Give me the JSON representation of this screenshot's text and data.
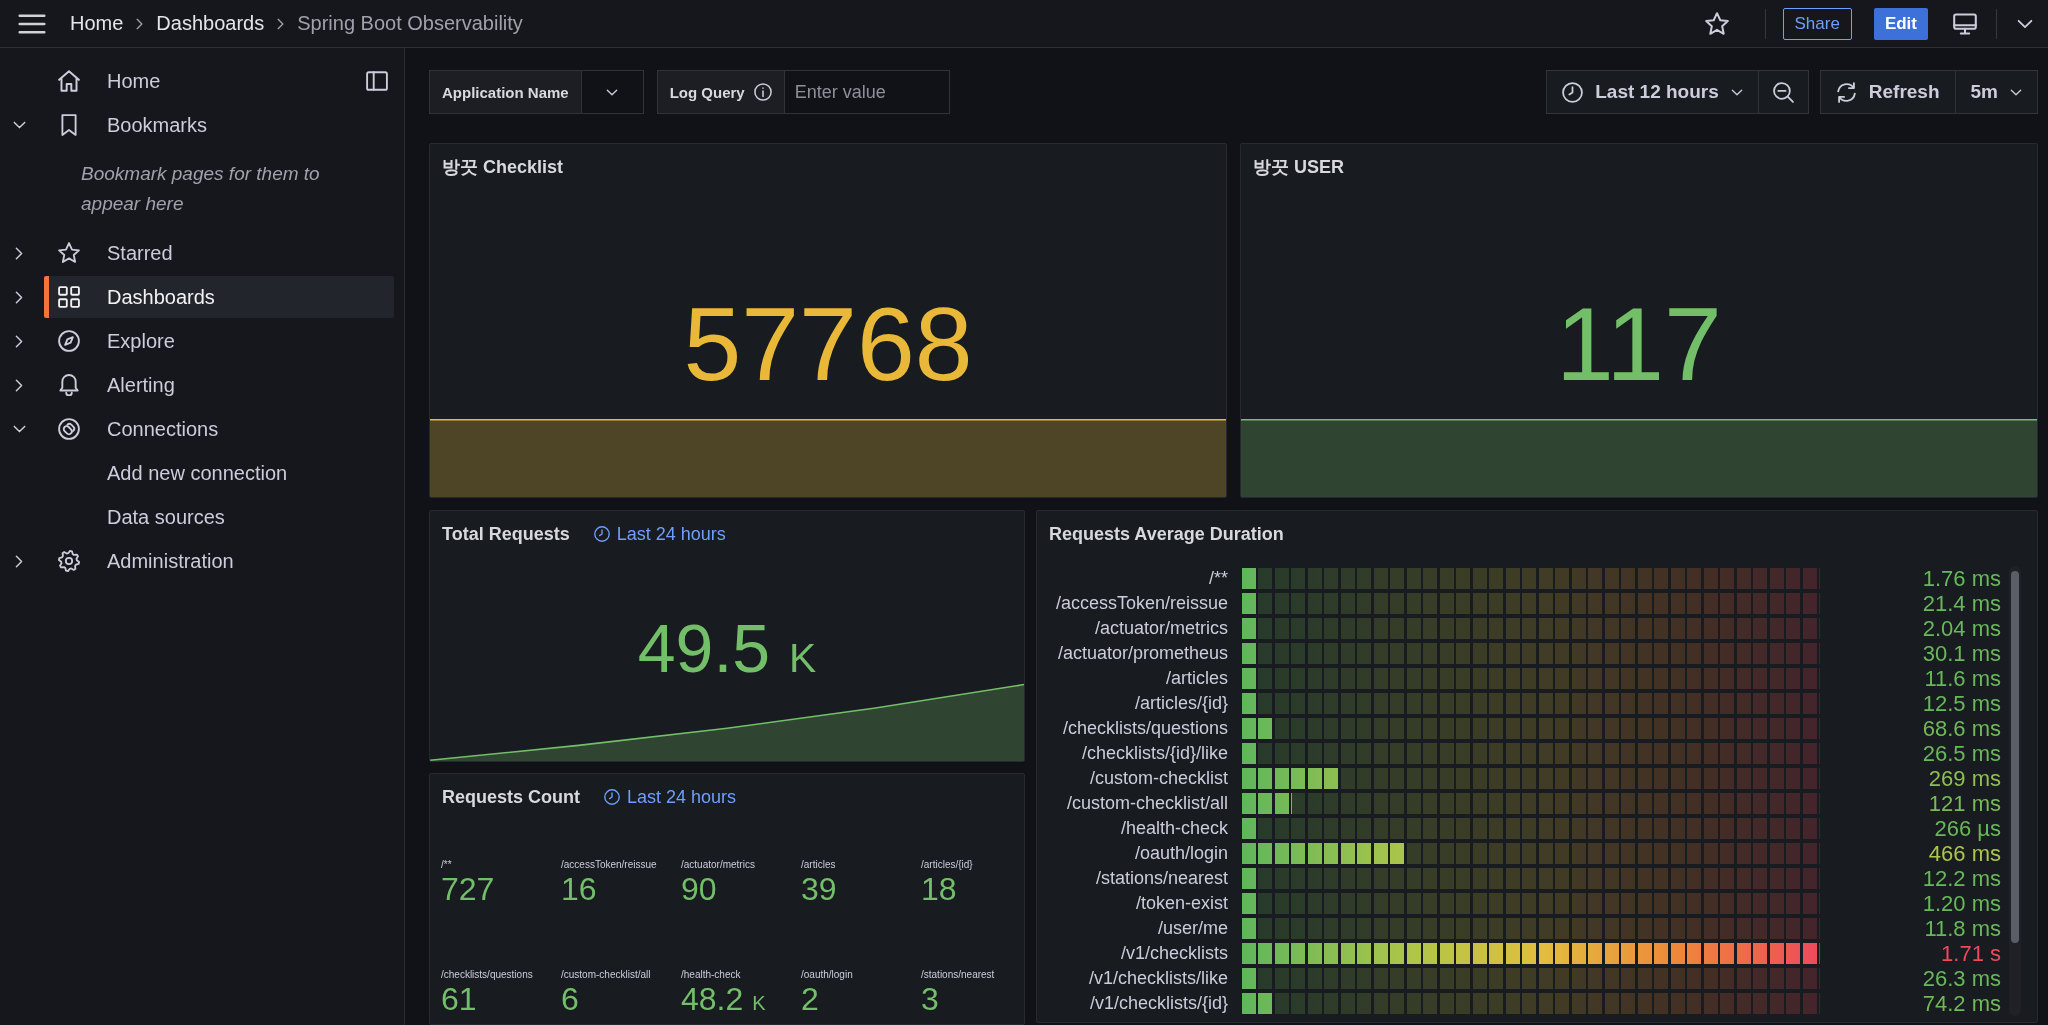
{
  "topbar": {
    "breadcrumbs": [
      {
        "label": "Home",
        "current": false
      },
      {
        "label": "Dashboards",
        "current": false
      },
      {
        "label": "Spring Boot Observability",
        "current": true
      }
    ],
    "share": "Share",
    "edit": "Edit"
  },
  "sidebar": {
    "items": [
      {
        "kind": "home",
        "label": "Home",
        "selected": false
      },
      {
        "kind": "bookmarks",
        "label": "Bookmarks",
        "selected": false,
        "expanded": true,
        "empty_message": "Bookmark pages for them to appear here"
      },
      {
        "kind": "starred",
        "label": "Starred",
        "selected": false,
        "expanded": false
      },
      {
        "kind": "dashboards",
        "label": "Dashboards",
        "selected": true,
        "expanded": false
      },
      {
        "kind": "explore",
        "label": "Explore",
        "selected": false,
        "expanded": false
      },
      {
        "kind": "alerting",
        "label": "Alerting",
        "selected": false,
        "expanded": false
      },
      {
        "kind": "connections",
        "label": "Connections",
        "selected": false,
        "expanded": true,
        "children": [
          {
            "label": "Add new connection",
            "selected": false
          },
          {
            "label": "Data sources",
            "selected": false
          }
        ]
      },
      {
        "kind": "administration",
        "label": "Administration",
        "selected": false,
        "expanded": false
      }
    ]
  },
  "variables": [
    {
      "kind": "select",
      "label": "Application Name"
    },
    {
      "kind": "text",
      "label": "Log Query",
      "info": true,
      "placeholder": "Enter value"
    }
  ],
  "time_controls": {
    "range": "Last 12 hours",
    "refresh": "Refresh",
    "interval": "5m"
  },
  "top_row": [
    {
      "kind": "stat",
      "title": "방끗 Checklist",
      "value": "57768",
      "color": "#eab839"
    },
    {
      "kind": "stat",
      "title": "방끗 USER",
      "value": "117",
      "color": "#73bf69"
    }
  ],
  "left_column": [
    {
      "kind": "stat",
      "title": "Total Requests",
      "time_override": "Last 24 hours",
      "value": "49.5",
      "unit": "K",
      "color": "#73bf69"
    },
    {
      "kind": "stat_grid",
      "title": "Requests Count",
      "time_override": "Last 24 hours",
      "items": [
        {
          "label": "/**",
          "value": "727"
        },
        {
          "label": "/accessToken/reissue",
          "value": "16"
        },
        {
          "label": "/actuator/metrics",
          "value": "90"
        },
        {
          "label": "/articles",
          "value": "39"
        },
        {
          "label": "/articles/{id}",
          "value": "18"
        },
        {
          "label": "/checklists/questions",
          "value": "61"
        },
        {
          "label": "/custom-checklist/all",
          "value": "6"
        },
        {
          "label": "/health-check",
          "value": "48.2",
          "unit": "K"
        },
        {
          "label": "/oauth/login",
          "value": "2"
        },
        {
          "label": "/stations/nearest",
          "value": "3"
        }
      ]
    }
  ],
  "right_column": [
    {
      "kind": "bar_gauge",
      "title": "Requests Average Duration",
      "rows": [
        {
          "label": "/**",
          "value": "1.76 ms",
          "level": 0.03
        },
        {
          "label": "/accessToken/reissue",
          "value": "21.4 ms",
          "level": 0.03
        },
        {
          "label": "/actuator/metrics",
          "value": "2.04 ms",
          "level": 0.03
        },
        {
          "label": "/actuator/prometheus",
          "value": "30.1 ms",
          "level": 0.03
        },
        {
          "label": "/articles",
          "value": "11.6 ms",
          "level": 0.03
        },
        {
          "label": "/articles/{id}",
          "value": "12.5 ms",
          "level": 0.03
        },
        {
          "label": "/checklists/questions",
          "value": "68.6 ms",
          "level": 0.06
        },
        {
          "label": "/checklists/{id}/like",
          "value": "26.5 ms",
          "level": 0.03
        },
        {
          "label": "/custom-checklist",
          "value": "269 ms",
          "level": 0.17
        },
        {
          "label": "/custom-checklist/all",
          "value": "121 ms",
          "level": 0.09
        },
        {
          "label": "/health-check",
          "value": "266 µs",
          "level": 0.03
        },
        {
          "label": "/oauth/login",
          "value": "466 ms",
          "level": 0.29
        },
        {
          "label": "/stations/nearest",
          "value": "12.2 ms",
          "level": 0.03
        },
        {
          "label": "/token-exist",
          "value": "1.20 ms",
          "level": 0.03
        },
        {
          "label": "/user/me",
          "value": "11.8 ms",
          "level": 0.03
        },
        {
          "label": "/v1/checklists",
          "value": "1.71 s",
          "level": 1
        },
        {
          "label": "/v1/checklists/like",
          "value": "26.3 ms",
          "level": 0.03
        },
        {
          "label": "/v1/checklists/{id}",
          "value": "74.2 ms",
          "level": 0.06
        }
      ]
    }
  ]
}
